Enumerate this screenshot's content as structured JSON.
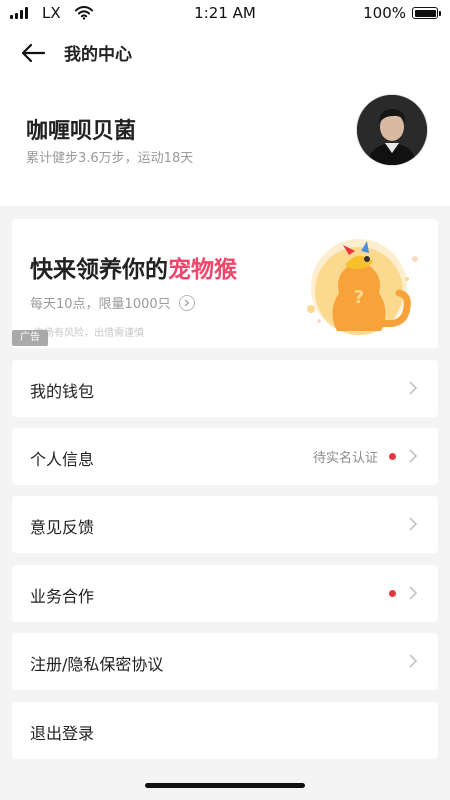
{
  "status_bar": {
    "carrier": "LX",
    "time": "1:21 AM",
    "battery": "100%",
    "battery_level": 1.0
  },
  "header": {
    "title": "我的中心",
    "back_icon": "arrow-left-icon"
  },
  "profile": {
    "name": "咖喱呗贝菌",
    "stats": "累计健步3.6万步，运动18天"
  },
  "ad": {
    "title_prefix": "快来领养你的",
    "title_highlight": "宠物猴",
    "subtitle": "每天10点，限量1000只",
    "risk_text": "市场有风险，出借需谨慎",
    "badge": "广告",
    "highlight_color": "#f0466a"
  },
  "menu": {
    "wallet": "我的钱包",
    "personal_info": "个人信息",
    "personal_info_status": "待实名认证",
    "feedback": "意见反馈",
    "cooperation": "业务合作",
    "privacy": "注册/隐私保密协议",
    "logout": "退出登录"
  },
  "colors": {
    "accent_red": "#e8353f",
    "background": "#f4f4f4"
  }
}
